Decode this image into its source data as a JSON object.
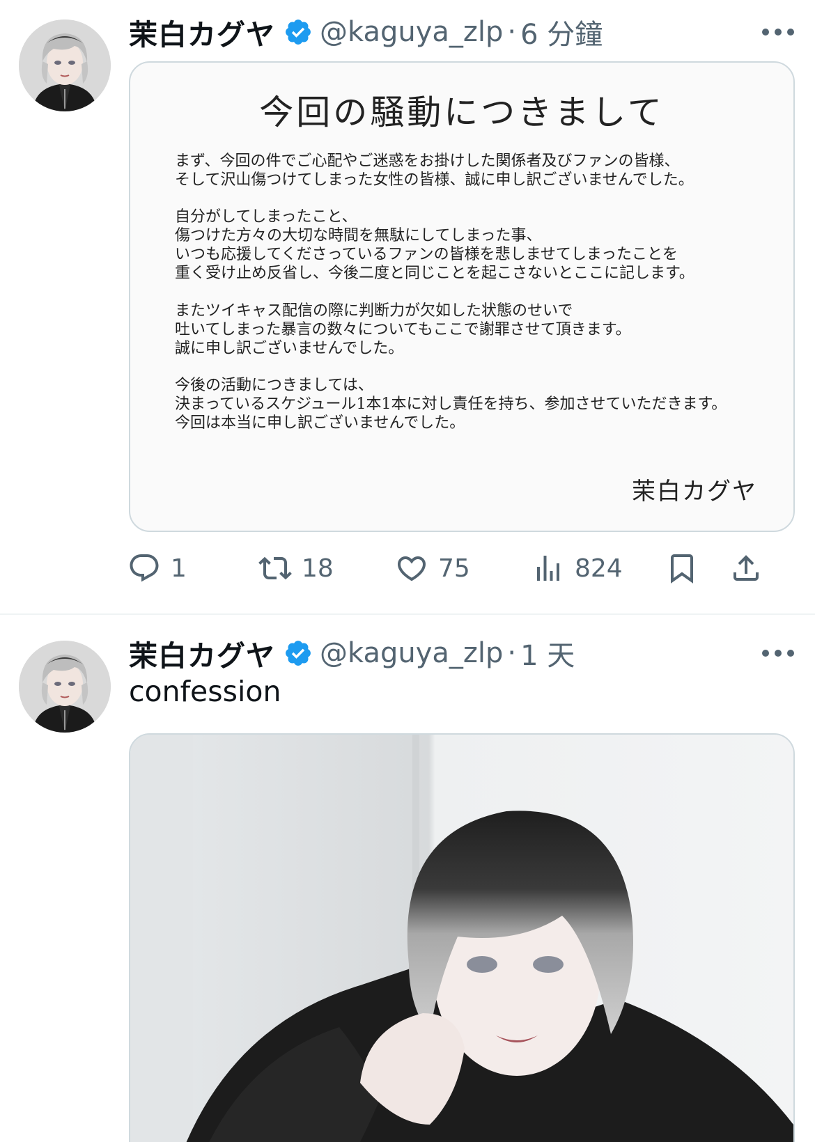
{
  "colors": {
    "text": "#0f1419",
    "secondary": "#536471",
    "verified": "#1d9bf0",
    "border": "#cfd9de"
  },
  "tweets": [
    {
      "author": {
        "name": "茉白カグヤ",
        "handle": "@kaguya_zlp",
        "verified_icon": "verified-badge-icon"
      },
      "separator": "·",
      "time": "6 分鐘",
      "notice": {
        "title": "今回の騒動につきまして",
        "paragraphs": [
          [
            "まず、今回の件でご心配やご迷惑をお掛けした関係者及びファンの皆様、",
            "そして沢山傷つけてしまった女性の皆様、誠に申し訳ございませんでした。"
          ],
          [
            "自分がしてしまったこと、",
            "傷つけた方々の大切な時間を無駄にしてしまった事、",
            "いつも応援してくださっているファンの皆様を悲しませてしまったことを",
            "重く受け止め反省し、今後二度と同じことを起こさないとここに記します。"
          ],
          [
            "またツイキャス配信の際に判断力が欠如した状態のせいで",
            "吐いてしまった暴言の数々についてもここで謝罪させて頂きます。",
            "誠に申し訳ございませんでした。"
          ],
          [
            "今後の活動につきましては、",
            "決まっているスケジュール1本1本に対し責任を持ち、参加させていただきます。",
            "今回は本当に申し訳ございませんでした。"
          ]
        ],
        "signature": "茉白カグヤ"
      },
      "actions": {
        "replies": "1",
        "retweets": "18",
        "likes": "75",
        "views": "824"
      }
    },
    {
      "author": {
        "name": "茉白カグヤ",
        "handle": "@kaguya_zlp",
        "verified_icon": "verified-badge-icon"
      },
      "separator": "·",
      "time": "1 天",
      "text": "confession"
    }
  ]
}
